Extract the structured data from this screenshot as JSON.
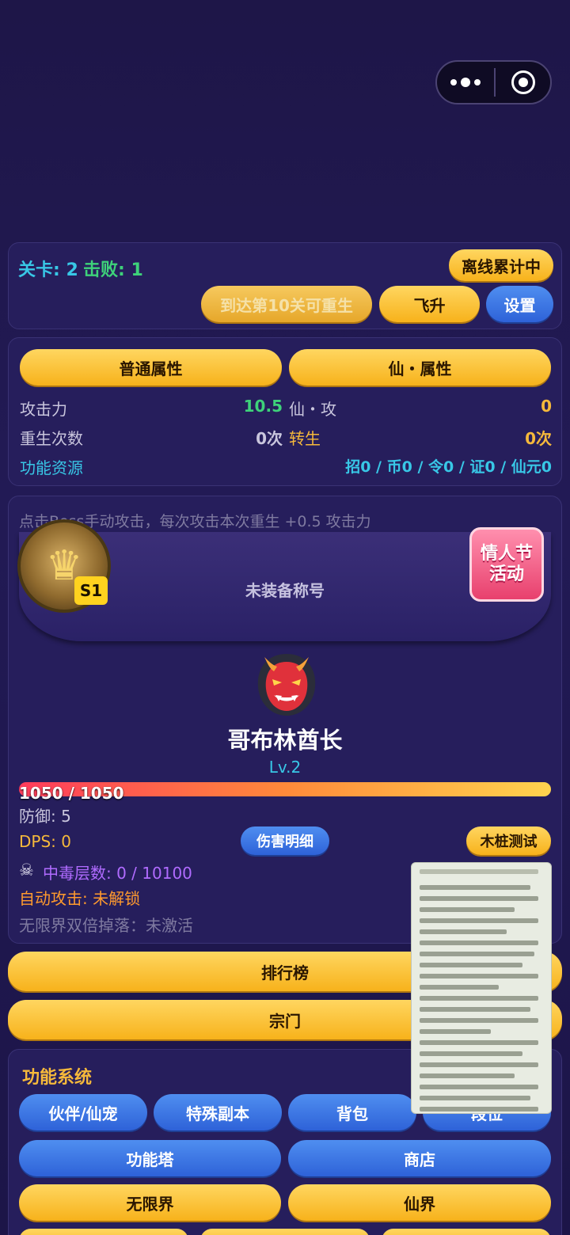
{
  "top": {
    "stage_label": "关卡: 2",
    "kills_label": "击败: 1",
    "offline": "离线累计中",
    "rebirth": "到达第10关可重生",
    "ascend": "飞升",
    "settings": "设置"
  },
  "attrs": {
    "tab_normal": "普通属性",
    "tab_immortal": "仙・属性",
    "atk_label": "攻击力",
    "atk_value": "10.5",
    "imm_atk_label": "仙・攻",
    "imm_atk_value": "0",
    "rebirth_label": "重生次数",
    "rebirth_value": "0次",
    "reincarnate_label": "转生",
    "reincarnate_value": "0次",
    "resource_label": "功能资源",
    "resource_value": "招0 / 币0 / 令0 / 证0 / 仙元0"
  },
  "boss": {
    "hint": "点击Boss手动攻击，每次攻击本次重生 +0.5 攻击力",
    "title_slot": "未装备称号",
    "season_badge": "S1",
    "event_text": "情人节活动",
    "name": "哥布林酋长",
    "level": "Lv.2",
    "hp_text": "1050 / 1050",
    "hp_fraction": 1.0,
    "defense": "防御: 5",
    "dps": "DPS: 0",
    "damage_detail": "伤害明细",
    "dummy_test": "木桩测试",
    "poison": "中毒层数: 0 / 10100",
    "auto_attack": "自动攻击: 未解锁",
    "double_drop": "无限界双倍掉落：未激活"
  },
  "buttons": {
    "rank": "排行榜",
    "sect": "宗门"
  },
  "systems": {
    "title": "功能系统",
    "row1": [
      "伙伴/仙宠",
      "特殊副本",
      "背包",
      "段位"
    ],
    "tower": "功能塔",
    "shop": "商店",
    "infinite": "无限界",
    "immortal_realm": "仙界"
  },
  "colors": {
    "accent_gold": "#f7b21b",
    "accent_blue": "#2e62d8",
    "background": "#221a55"
  }
}
